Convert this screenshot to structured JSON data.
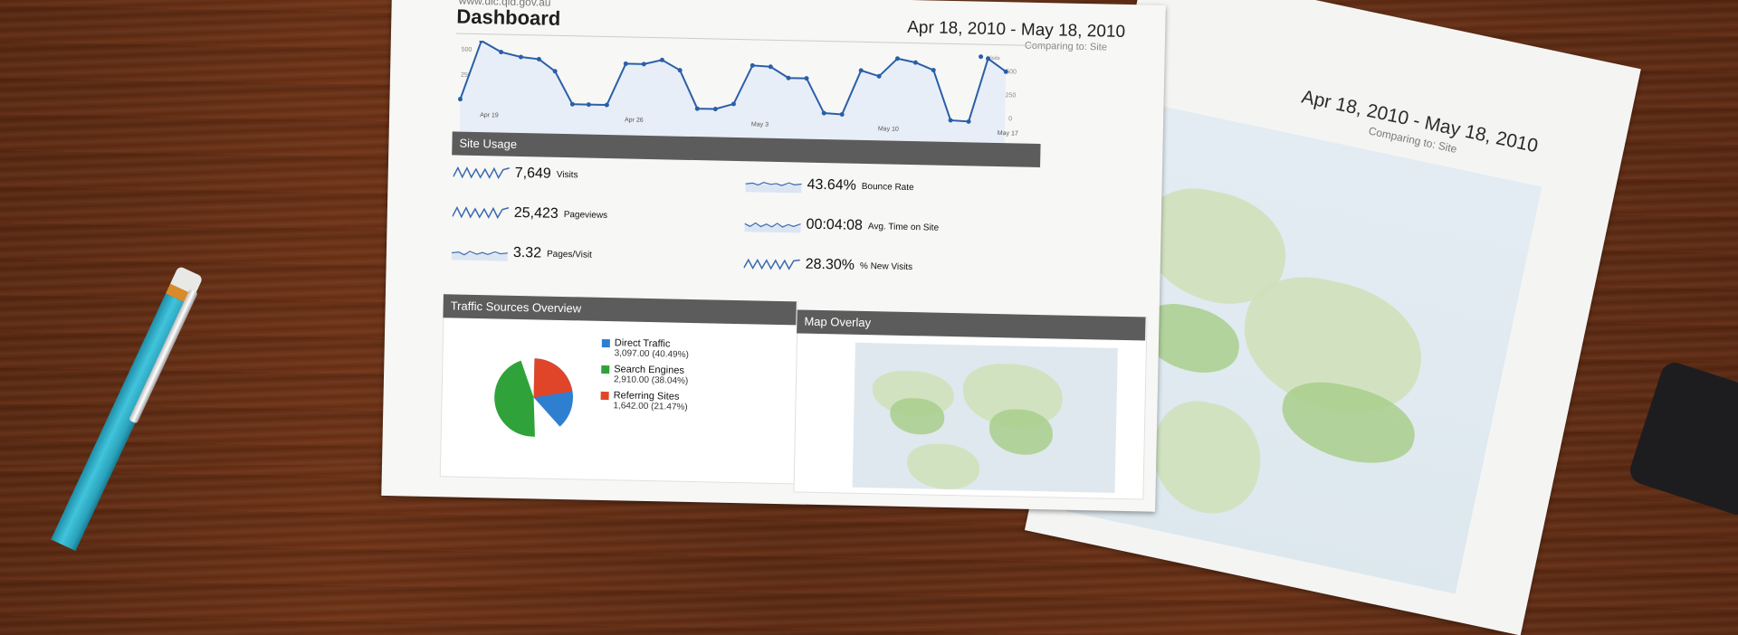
{
  "sheet_main": {
    "url": "www.dlc.qld.gov.au",
    "title": "Dashboard",
    "date_range": "Apr 18, 2010 - May 18, 2010",
    "comparing": "Comparing to: Site",
    "chart": {
      "legend_label": "Visits",
      "y_ticks": [
        "500",
        "250",
        "0"
      ],
      "x_labels": [
        "Apr 19",
        "Apr 26",
        "May 3",
        "May 10",
        "May 17"
      ]
    },
    "site_usage": {
      "header": "Site Usage",
      "metrics": [
        {
          "value": "7,649",
          "label": "Visits"
        },
        {
          "value": "25,423",
          "label": "Pageviews"
        },
        {
          "value": "3.32",
          "label": "Pages/Visit"
        },
        {
          "value": "43.64%",
          "label": "Bounce Rate"
        },
        {
          "value": "00:04:08",
          "label": "Avg. Time on Site"
        },
        {
          "value": "28.30%",
          "label": "% New Visits"
        }
      ]
    },
    "traffic_sources": {
      "header": "Traffic Sources Overview",
      "items": [
        {
          "name": "Direct Traffic",
          "value": "3,097.00 (40.49%)",
          "color": "#2f7fd0"
        },
        {
          "name": "Search Engines",
          "value": "2,910.00 (38.04%)",
          "color": "#2fa33a"
        },
        {
          "name": "Referring Sites",
          "value": "1,642.00 (21.47%)",
          "color": "#e0452a"
        }
      ]
    },
    "map_overlay": {
      "header": "Map Overlay"
    }
  },
  "sheet_second": {
    "date_range": "Apr 18, 2010 - May 18, 2010",
    "comparing": "Comparing to: Site"
  }
}
